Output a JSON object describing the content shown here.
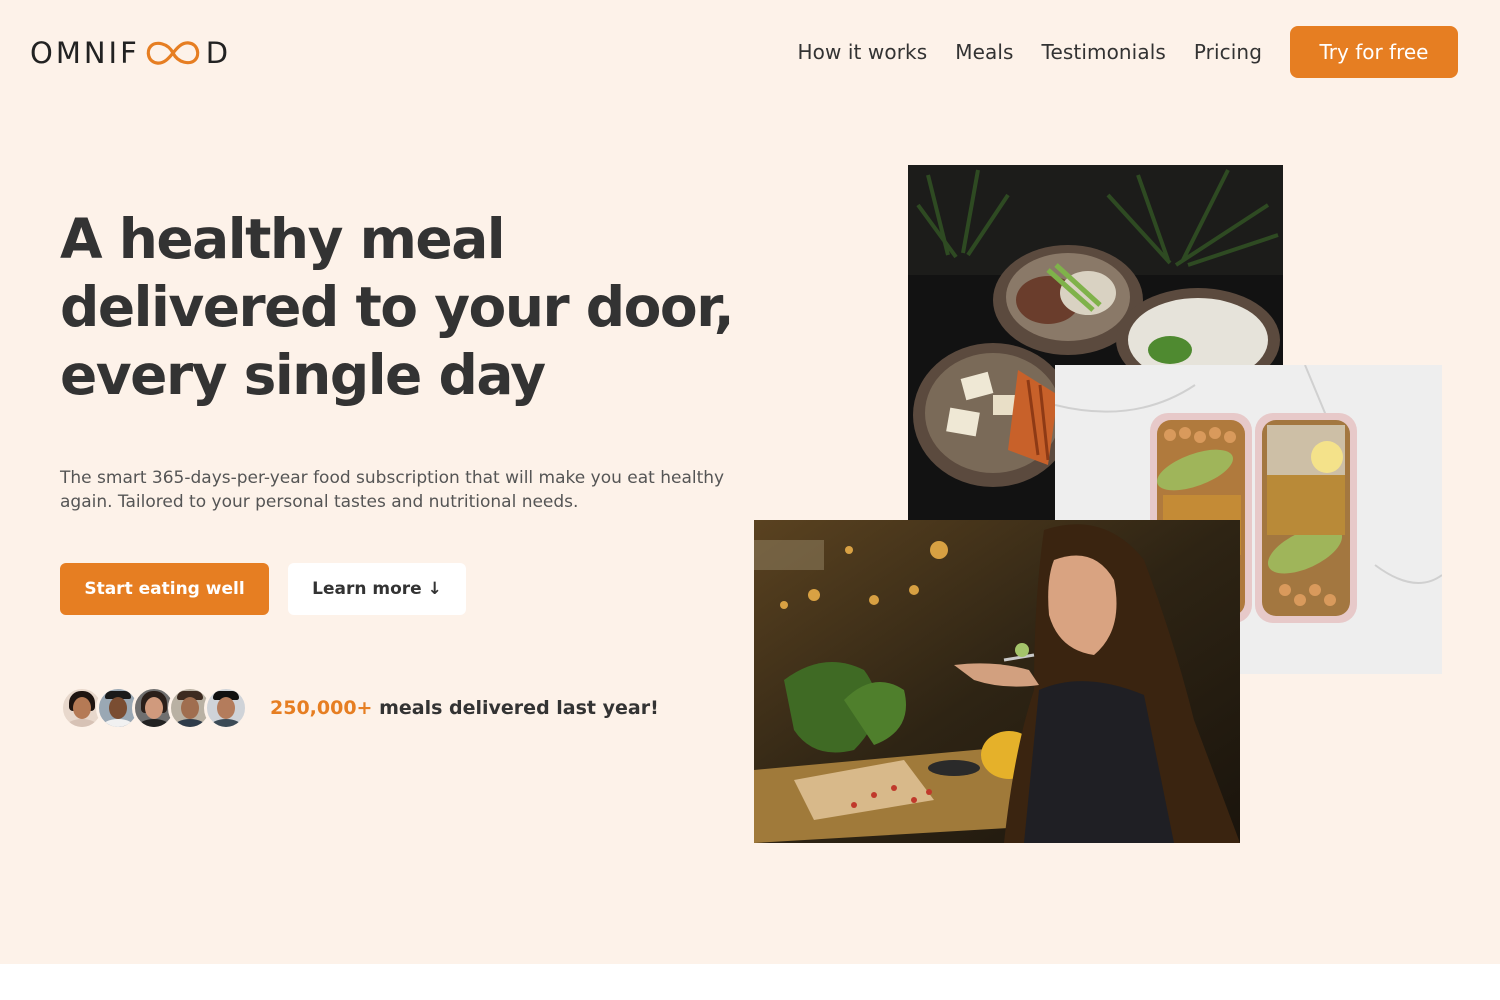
{
  "header": {
    "logo_text_start": "OMNIF",
    "logo_text_end": "D",
    "logo_icon": "infinity-oo-icon",
    "nav": [
      {
        "label": "How it works"
      },
      {
        "label": "Meals"
      },
      {
        "label": "Testimonials"
      },
      {
        "label": "Pricing"
      }
    ],
    "cta_label": "Try for free"
  },
  "hero": {
    "title_lines": [
      "A healthy meal",
      "delivered to your door,",
      "every single day"
    ],
    "description": "The smart 365-days-per-year food subscription that will make you eat healthy again. Tailored to your personal tastes and nutritional needs.",
    "primary_button": "Start eating well",
    "secondary_button": "Learn more ↓",
    "delivered_count": "250,000+",
    "delivered_text": " meals delivered last year!"
  },
  "colors": {
    "accent": "#e67e22",
    "hero_background": "#fdf2e9",
    "text": "#333333"
  }
}
